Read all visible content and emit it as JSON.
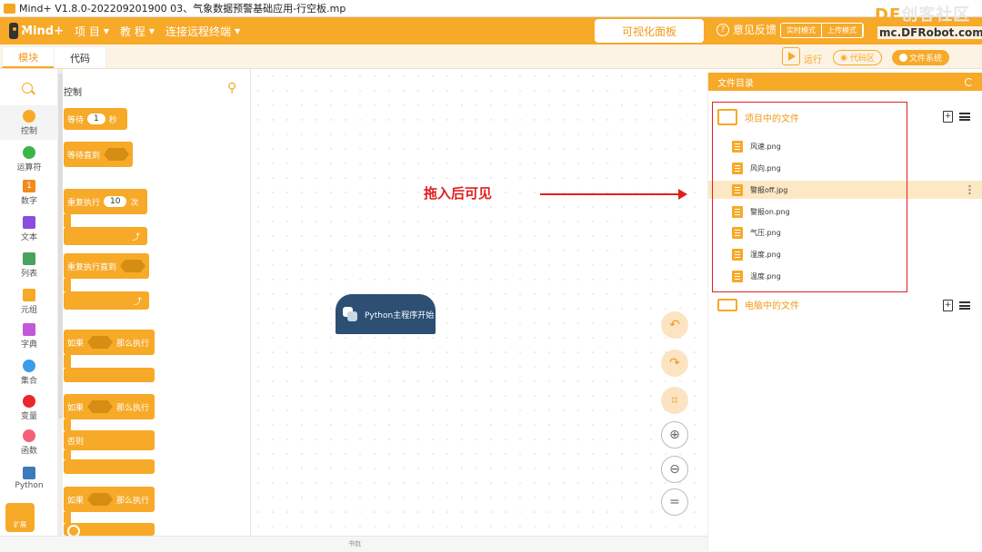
{
  "titlebar": {
    "title": "Mind+ V1.8.0-202209201900   03、气象数据预警基础应用-行空板.mp"
  },
  "watermark": {
    "brand_df": "DF",
    "brand_rest": "创客社区",
    "url": "mc.DFRobot.com.cn"
  },
  "menubar": {
    "logo": "Mind+",
    "items": [
      {
        "label": "项 目"
      },
      {
        "label": "教 程"
      },
      {
        "label": "连接远程终端"
      }
    ],
    "visual_panel": "可视化面板",
    "feedback": "意见反馈",
    "modes": [
      {
        "label": "实时模式"
      },
      {
        "label": "上传模式"
      }
    ],
    "accent_color": "#f7a928"
  },
  "tabs": [
    {
      "label": "模块"
    },
    {
      "label": "代码"
    }
  ],
  "toolbar": {
    "run": "运行",
    "code_area": "代码区",
    "file_system": "文件系统"
  },
  "categories": [
    {
      "label": "控制",
      "icon": "control-icon",
      "color": "#f7a928"
    },
    {
      "label": "运算符",
      "icon": "operator-icon",
      "color": "#3bb44a"
    },
    {
      "label": "数字",
      "icon": "number-icon",
      "color": "#f28a1c",
      "glyph": "1"
    },
    {
      "label": "文本",
      "icon": "text-icon",
      "color": "#8a4de0"
    },
    {
      "label": "列表",
      "icon": "list-icon",
      "color": "#4aa35c"
    },
    {
      "label": "元组",
      "icon": "tuple-icon",
      "color": "#f7a928"
    },
    {
      "label": "字典",
      "icon": "dict-icon",
      "color": "#c05ad8"
    },
    {
      "label": "集合",
      "icon": "set-icon",
      "color": "#3b9de8"
    },
    {
      "label": "变量",
      "icon": "variable-icon",
      "color": "#e8262c"
    },
    {
      "label": "函数",
      "icon": "function-icon",
      "color": "#f4607a"
    },
    {
      "label": "Python",
      "icon": "python-icon",
      "color": "#3d7ab8"
    }
  ],
  "extension": {
    "label": "扩展"
  },
  "blocks": {
    "header": "控制",
    "wait": {
      "prefix": "等待",
      "value": "1",
      "suffix": "秒"
    },
    "wait_until": "等待直到",
    "repeat": {
      "prefix": "重复执行",
      "value": "10",
      "suffix": "次"
    },
    "repeat_until": "重复执行直到",
    "if_then": {
      "if": "如果",
      "then": "那么执行"
    },
    "if_else": {
      "if": "如果",
      "then": "那么执行",
      "else": "否则"
    },
    "if_then2": {
      "if": "如果",
      "then": "那么执行"
    }
  },
  "workspace": {
    "start_block": "Python主程序开始",
    "annotation": "拖入后可见",
    "tools": [
      {
        "icon": "undo-icon"
      },
      {
        "icon": "redo-icon"
      },
      {
        "icon": "crop-icon"
      },
      {
        "icon": "zoom-in-icon"
      },
      {
        "icon": "zoom-out-icon"
      },
      {
        "icon": "reset-zoom-icon"
      }
    ],
    "reset_glyph": "="
  },
  "backpack": "书包",
  "files": {
    "title": "文件目录",
    "project_section": "项目中的文件",
    "project_files": [
      {
        "name": "风速.png"
      },
      {
        "name": "风向.png"
      },
      {
        "name": "警报off.jpg"
      },
      {
        "name": "警报on.png"
      },
      {
        "name": "气压.png"
      },
      {
        "name": "湿度.png"
      },
      {
        "name": "温度.png"
      }
    ],
    "selected_index": 2,
    "computer_section": "电脑中的文件"
  }
}
